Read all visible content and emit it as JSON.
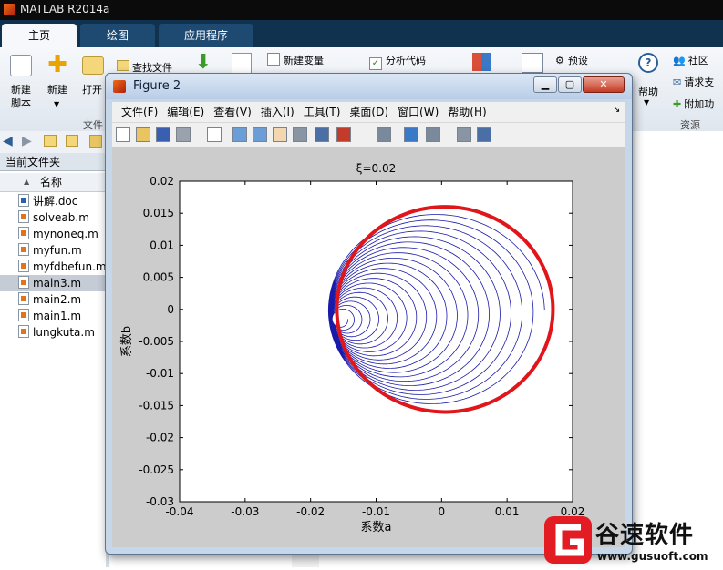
{
  "app": {
    "title": "MATLAB R2014a"
  },
  "tabs": [
    {
      "label": "主页"
    },
    {
      "label": "绘图"
    },
    {
      "label": "应用程序"
    }
  ],
  "ribbon": {
    "new_script": "新建\n脚本",
    "new_script_l1": "新建",
    "new_script_l2": "脚本",
    "new": "新建",
    "open": "打开",
    "find_files": "查找文件",
    "new_variable": "新建变量",
    "analyze_code": "分析代码",
    "preferences": "预设",
    "community": "社区",
    "request_support": "请求支",
    "help": "帮助",
    "addons": "附加功",
    "file_group": "文件",
    "resources_group": "资源"
  },
  "left_panel": {
    "current_folder": "当前文件夹",
    "name_header": "名称",
    "sort_arrow": "▲",
    "files": [
      {
        "name": "讲解.doc",
        "type": "doc"
      },
      {
        "name": "solveab.m",
        "type": "m"
      },
      {
        "name": "mynoneq.m",
        "type": "m"
      },
      {
        "name": "myfun.m",
        "type": "m"
      },
      {
        "name": "myfdbefun.m",
        "type": "m"
      },
      {
        "name": "main3.m",
        "type": "m",
        "selected": true
      },
      {
        "name": "main2.m",
        "type": "m"
      },
      {
        "name": "main1.m",
        "type": "m"
      },
      {
        "name": "lungkuta.m",
        "type": "m"
      }
    ]
  },
  "figure": {
    "title": "Figure 2",
    "menu": [
      "文件(F)",
      "编辑(E)",
      "查看(V)",
      "插入(I)",
      "工具(T)",
      "桌面(D)",
      "窗口(W)",
      "帮助(H)"
    ],
    "dock_arrow": "↘",
    "toolbar_icons": [
      "new-figure-icon",
      "open-icon",
      "save-icon",
      "print-icon",
      "pointer-icon",
      "zoom-in-icon",
      "zoom-out-icon",
      "pan-icon",
      "rotate-icon",
      "data-cursor-icon",
      "brush-icon",
      "link-icon",
      "colorbar-icon",
      "legend-icon",
      "hide-plot-tools-icon",
      "show-plot-tools-icon"
    ]
  },
  "chart_data": {
    "type": "line",
    "title": "ξ=0.02",
    "xlabel": "系数a",
    "ylabel": "系数b",
    "xlim": [
      -0.04,
      0.02
    ],
    "ylim": [
      -0.03,
      0.02
    ],
    "xticks": [
      "-0.04",
      "-0.03",
      "-0.02",
      "-0.01",
      "0",
      "0.01",
      "0.02"
    ],
    "yticks": [
      "0.02",
      "0.015",
      "0.01",
      "0.005",
      "0",
      "-0.005",
      "-0.01",
      "-0.015",
      "-0.02",
      "-0.025",
      "-0.03"
    ],
    "series": [
      {
        "color": "#1a1aa8",
        "spiral": {
          "start": [
            0.016,
            0.0
          ],
          "center_end": [
            -0.0155,
            -0.0015
          ],
          "turns": 20
        }
      }
    ],
    "annotation": {
      "shape": "circle",
      "color": "#e0161b",
      "center": [
        0.0005,
        0.0
      ],
      "rx": 0.0165,
      "ry": 0.016
    }
  },
  "watermark": {
    "brand": "谷速软件",
    "url": "www.gusuoft.com",
    "accent": "#e31b23"
  }
}
